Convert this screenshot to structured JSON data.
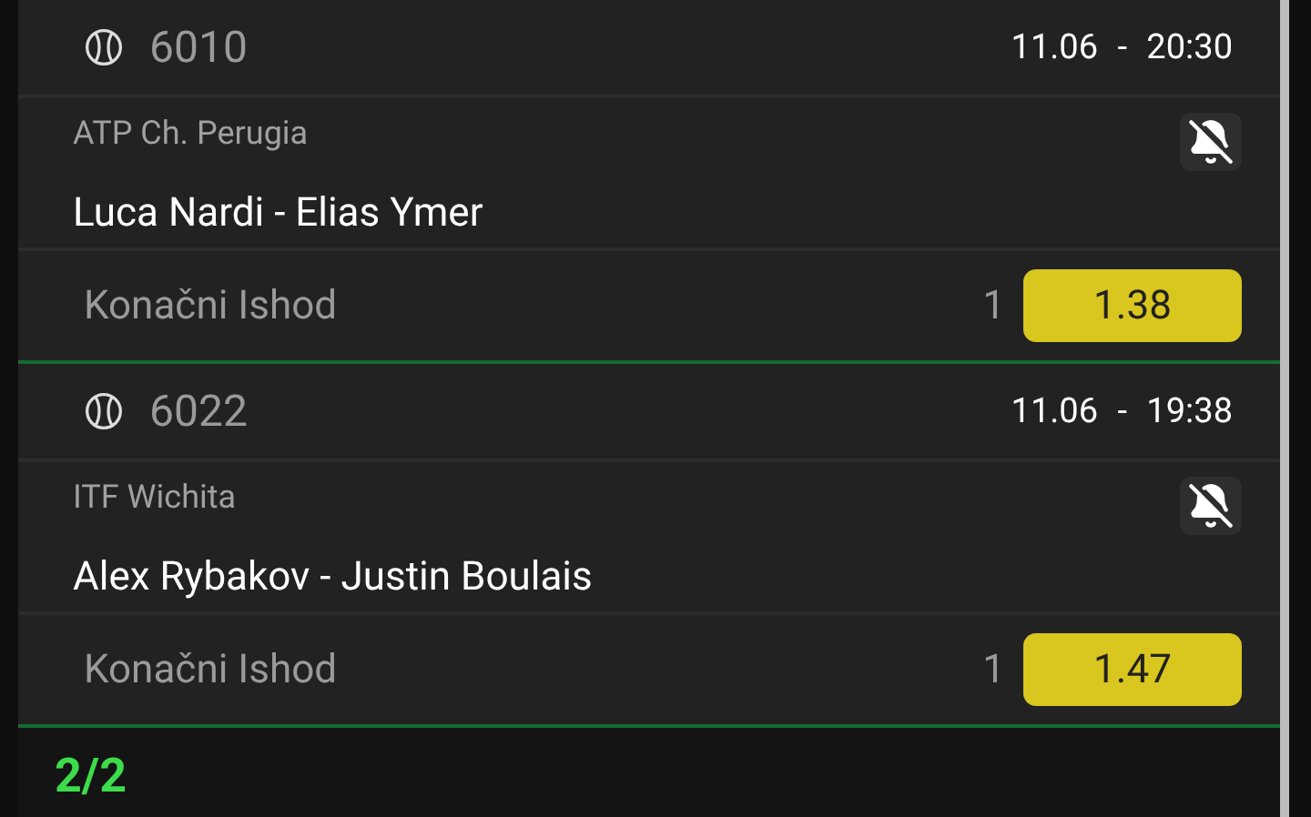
{
  "events": [
    {
      "code": "6010",
      "datetime": "11.06 - 20:30",
      "league": "ATP Ch. Perugia",
      "match": "Luca Nardi - Elias Ymer",
      "notifications_on": false,
      "market": "Konačni Ishod",
      "outcome": "1",
      "odds": "1.38",
      "selected": true
    },
    {
      "code": "6022",
      "datetime": "11.06 - 19:38",
      "league": "ITF Wichita",
      "match": "Alex Rybakov - Justin Boulais",
      "notifications_on": false,
      "market": "Konačni Ishod",
      "outcome": "1",
      "odds": "1.47",
      "selected": true
    }
  ],
  "pager": "2/2"
}
